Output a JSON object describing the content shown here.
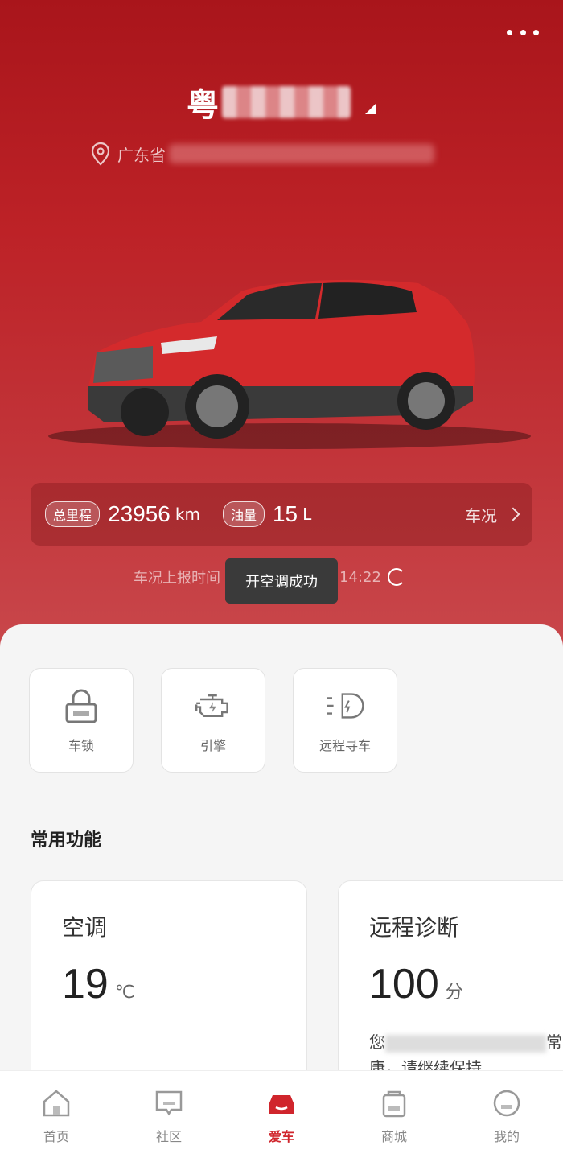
{
  "header": {
    "plate_prefix": "粤",
    "location_prefix": "广东省"
  },
  "stats": {
    "mileage_label": "总里程",
    "mileage_value": "23956",
    "mileage_unit": "km",
    "fuel_label": "油量",
    "fuel_value": "15",
    "fuel_unit": "L",
    "status_link": "车况"
  },
  "report": {
    "label": "车况上报时间",
    "time": ":14:22"
  },
  "toast": "开空调成功",
  "quick_actions": [
    {
      "label": "车锁",
      "icon": "lock-icon"
    },
    {
      "label": "引擎",
      "icon": "engine-icon"
    },
    {
      "label": "远程寻车",
      "icon": "headlight-icon"
    }
  ],
  "section_title": "常用功能",
  "features": {
    "ac": {
      "title": "空调",
      "value": "19",
      "unit": "℃"
    },
    "diagnosis": {
      "title": "远程诊断",
      "value": "100",
      "unit": "分",
      "desc_start": "您",
      "desc_end": "常",
      "desc_line2": "康，请继续保持"
    }
  },
  "tabbar": [
    {
      "label": "首页",
      "icon": "home-icon"
    },
    {
      "label": "社区",
      "icon": "community-icon"
    },
    {
      "label": "爱车",
      "icon": "car-icon"
    },
    {
      "label": "商城",
      "icon": "shop-icon"
    },
    {
      "label": "我的",
      "icon": "profile-icon"
    }
  ],
  "colors": {
    "brand": "#d0252c",
    "hero_top": "#a9151b",
    "hero_bottom": "#c9484c"
  }
}
